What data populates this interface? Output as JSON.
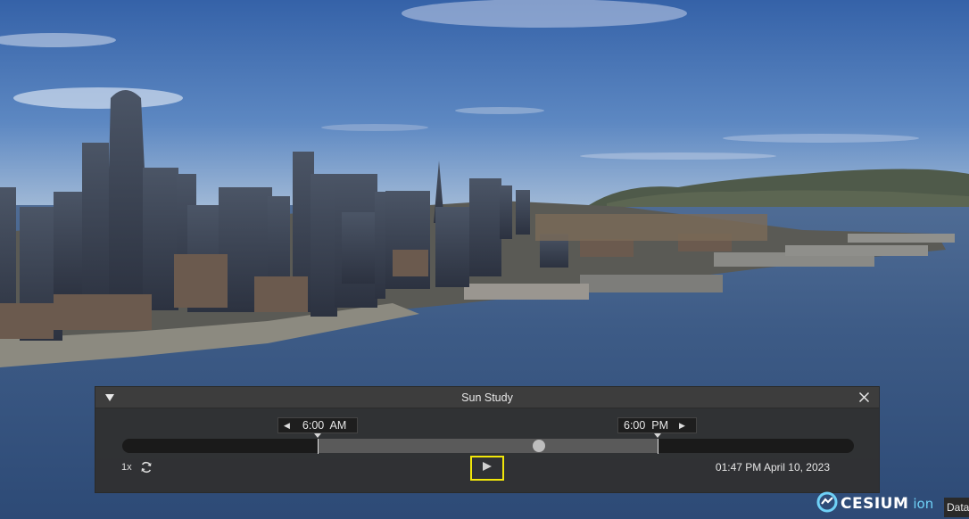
{
  "panel": {
    "title": "Sun Study",
    "start_time": "6:00  AM",
    "end_time": "6:00  PM",
    "speed": "1x",
    "current_datetime": "01:47 PM April 10, 2023",
    "play_progress_fraction": 0.65
  },
  "logo": {
    "brand": "CESIUM",
    "product": "ion"
  },
  "data_tab": {
    "label": "Data"
  },
  "icons": {
    "collapse": "triangle-down-icon",
    "close": "close-icon",
    "start_decrement": "triangle-left-icon",
    "end_increment": "triangle-right-icon",
    "loop": "refresh-icon",
    "play": "play-icon"
  },
  "colors": {
    "play_highlight": "#f1e60a",
    "logo_ion": "#6fd1f7"
  }
}
